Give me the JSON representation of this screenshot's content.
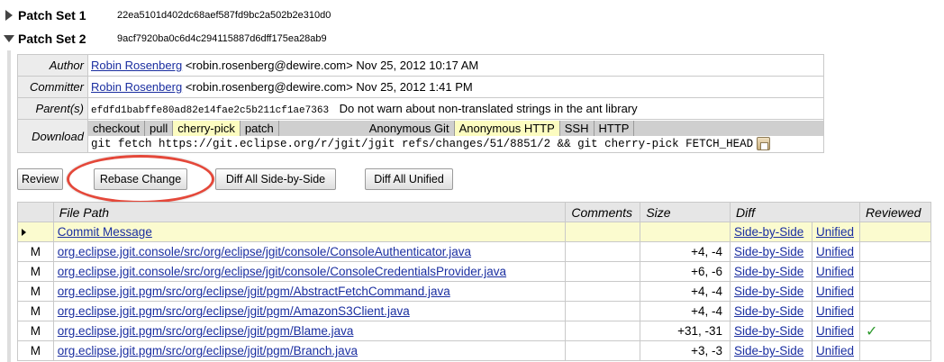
{
  "patch_sets": [
    {
      "label": "Patch Set 1",
      "hash": "22ea5101d402dc68aef587fd9bc2a502b2e310d0",
      "expanded": false
    },
    {
      "label": "Patch Set 2",
      "hash": "9acf7920ba0c6d4c294115887d6dff175ea28ab9",
      "expanded": true
    }
  ],
  "info": {
    "author": {
      "label": "Author",
      "name": "Robin Rosenberg",
      "email": "<robin.rosenberg@dewire.com>",
      "date": "Nov 25, 2012 10:17 AM"
    },
    "committer": {
      "label": "Committer",
      "name": "Robin Rosenberg",
      "email": "<robin.rosenberg@dewire.com>",
      "date": "Nov 25, 2012 1:41 PM"
    },
    "parents": {
      "label": "Parent(s)",
      "hash": "efdfd1babffe80ad82e14fae2c5b211cf1ae7363",
      "message": "Do not warn about non-translated strings in the ant library"
    },
    "download": {
      "label": "Download",
      "tabs": [
        "checkout",
        "pull",
        "cherry-pick",
        "patch"
      ],
      "selected_tab": "cherry-pick",
      "proto_tabs": [
        "Anonymous Git",
        "Anonymous HTTP",
        "SSH",
        "HTTP"
      ],
      "selected_proto": "Anonymous HTTP",
      "command": "git fetch https://git.eclipse.org/r/jgit/jgit refs/changes/51/8851/2 && git cherry-pick FETCH_HEAD"
    }
  },
  "buttons": {
    "review": "Review",
    "rebase": "Rebase Change",
    "diff_side": "Diff All Side-by-Side",
    "diff_unified": "Diff All Unified"
  },
  "files": {
    "headers": {
      "path": "File Path",
      "comments": "Comments",
      "size": "Size",
      "diff": "Diff",
      "reviewed": "Reviewed"
    },
    "rows": [
      {
        "mode": "",
        "path": "Commit Message",
        "comments": "",
        "size": "",
        "side": "Side-by-Side",
        "unified": "Unified",
        "reviewed": false
      },
      {
        "mode": "M",
        "path": "org.eclipse.jgit.console/src/org/eclipse/jgit/console/ConsoleAuthenticator.java",
        "comments": "",
        "size": "+4, -4",
        "side": "Side-by-Side",
        "unified": "Unified",
        "reviewed": false
      },
      {
        "mode": "M",
        "path": "org.eclipse.jgit.console/src/org/eclipse/jgit/console/ConsoleCredentialsProvider.java",
        "comments": "",
        "size": "+6, -6",
        "side": "Side-by-Side",
        "unified": "Unified",
        "reviewed": false
      },
      {
        "mode": "M",
        "path": "org.eclipse.jgit.pgm/src/org/eclipse/jgit/pgm/AbstractFetchCommand.java",
        "comments": "",
        "size": "+4, -4",
        "side": "Side-by-Side",
        "unified": "Unified",
        "reviewed": false
      },
      {
        "mode": "M",
        "path": "org.eclipse.jgit.pgm/src/org/eclipse/jgit/pgm/AmazonS3Client.java",
        "comments": "",
        "size": "+4, -4",
        "side": "Side-by-Side",
        "unified": "Unified",
        "reviewed": false
      },
      {
        "mode": "M",
        "path": "org.eclipse.jgit.pgm/src/org/eclipse/jgit/pgm/Blame.java",
        "comments": "",
        "size": "+31, -31",
        "side": "Side-by-Side",
        "unified": "Unified",
        "reviewed": true
      },
      {
        "mode": "M",
        "path": "org.eclipse.jgit.pgm/src/org/eclipse/jgit/pgm/Branch.java",
        "comments": "",
        "size": "+3, -3",
        "side": "Side-by-Side",
        "unified": "Unified",
        "reviewed": false
      }
    ]
  },
  "colors": {
    "link": "#1a2ea0",
    "selected_tab": "#fcfcc0",
    "active_row": "#fbfbcf",
    "highlight_oval": "#e4483a",
    "check": "#2e9a2e"
  },
  "icons": {
    "collapsed": "triangle-right-icon",
    "expanded": "triangle-down-icon",
    "copy": "clipboard-icon",
    "reviewed": "checkmark-icon",
    "row_pointer": "pointer-arrow-icon"
  }
}
